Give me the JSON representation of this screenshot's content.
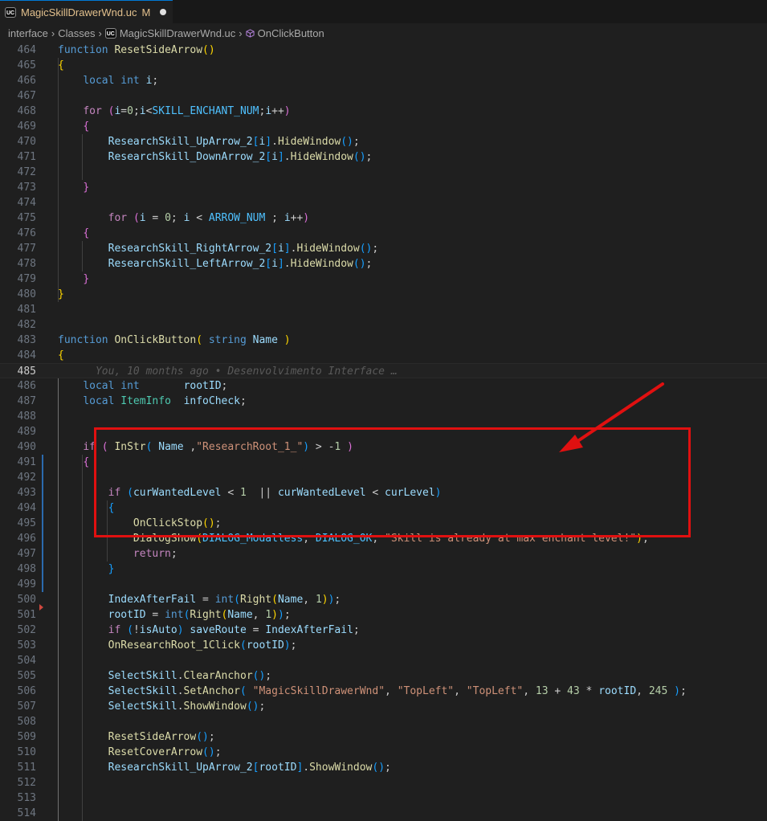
{
  "tab": {
    "badge": "UC",
    "title": "MagicSkillDrawerWnd.uc",
    "status": "M"
  },
  "breadcrumb": {
    "items": [
      "interface",
      "Classes",
      "MagicSkillDrawerWnd.uc",
      "OnClickButton"
    ],
    "file_badge": "UC"
  },
  "editor": {
    "active_line": "485",
    "git_blame": "You, 10 months ago • Desenvolvimento Interface …",
    "lines": [
      {
        "n": "464",
        "tokens": [
          [
            "t-kw",
            "function "
          ],
          [
            "t-fn",
            "ResetSideArrow"
          ],
          [
            "t-b1",
            "()"
          ]
        ]
      },
      {
        "n": "465",
        "tokens": [
          [
            "t-b1",
            "{"
          ]
        ]
      },
      {
        "n": "466",
        "tokens": [
          [
            "t-pl",
            "    "
          ],
          [
            "t-kw",
            "local "
          ],
          [
            "t-kw",
            "int "
          ],
          [
            "t-var",
            "i"
          ],
          [
            "t-pl",
            ";"
          ]
        ]
      },
      {
        "n": "467",
        "tokens": []
      },
      {
        "n": "468",
        "tokens": [
          [
            "t-pl",
            "    "
          ],
          [
            "t-ctl",
            "for "
          ],
          [
            "t-b2",
            "("
          ],
          [
            "t-var",
            "i"
          ],
          [
            "t-pl",
            "="
          ],
          [
            "t-num",
            "0"
          ],
          [
            "t-pl",
            ";"
          ],
          [
            "t-var",
            "i"
          ],
          [
            "t-pl",
            "<"
          ],
          [
            "t-con",
            "SKILL_ENCHANT_NUM"
          ],
          [
            "t-pl",
            ";"
          ],
          [
            "t-var",
            "i"
          ],
          [
            "t-pl",
            "++"
          ],
          [
            "t-b2",
            ")"
          ]
        ]
      },
      {
        "n": "469",
        "tokens": [
          [
            "t-pl",
            "    "
          ],
          [
            "t-b2",
            "{"
          ]
        ]
      },
      {
        "n": "470",
        "tokens": [
          [
            "t-pl",
            "        "
          ],
          [
            "t-var",
            "ResearchSkill_UpArrow_2"
          ],
          [
            "t-b3",
            "["
          ],
          [
            "t-var",
            "i"
          ],
          [
            "t-b3",
            "]"
          ],
          [
            "t-pl",
            "."
          ],
          [
            "t-fn",
            "HideWindow"
          ],
          [
            "t-b3",
            "()"
          ],
          [
            "t-pl",
            ";"
          ]
        ]
      },
      {
        "n": "471",
        "tokens": [
          [
            "t-pl",
            "        "
          ],
          [
            "t-var",
            "ResearchSkill_DownArrow_2"
          ],
          [
            "t-b3",
            "["
          ],
          [
            "t-var",
            "i"
          ],
          [
            "t-b3",
            "]"
          ],
          [
            "t-pl",
            "."
          ],
          [
            "t-fn",
            "HideWindow"
          ],
          [
            "t-b3",
            "()"
          ],
          [
            "t-pl",
            ";"
          ]
        ]
      },
      {
        "n": "472",
        "tokens": []
      },
      {
        "n": "473",
        "tokens": [
          [
            "t-pl",
            "    "
          ],
          [
            "t-b2",
            "}"
          ]
        ]
      },
      {
        "n": "474",
        "tokens": []
      },
      {
        "n": "475",
        "tokens": [
          [
            "t-pl",
            "        "
          ],
          [
            "t-ctl",
            "for "
          ],
          [
            "t-b2",
            "("
          ],
          [
            "t-var",
            "i"
          ],
          [
            "t-pl",
            " = "
          ],
          [
            "t-num",
            "0"
          ],
          [
            "t-pl",
            "; "
          ],
          [
            "t-var",
            "i"
          ],
          [
            "t-pl",
            " < "
          ],
          [
            "t-con",
            "ARROW_NUM"
          ],
          [
            "t-pl",
            " ; "
          ],
          [
            "t-var",
            "i"
          ],
          [
            "t-pl",
            "++"
          ],
          [
            "t-b2",
            ")"
          ]
        ]
      },
      {
        "n": "476",
        "tokens": [
          [
            "t-pl",
            "    "
          ],
          [
            "t-b2",
            "{"
          ]
        ]
      },
      {
        "n": "477",
        "tokens": [
          [
            "t-pl",
            "        "
          ],
          [
            "t-var",
            "ResearchSkill_RightArrow_2"
          ],
          [
            "t-b3",
            "["
          ],
          [
            "t-var",
            "i"
          ],
          [
            "t-b3",
            "]"
          ],
          [
            "t-pl",
            "."
          ],
          [
            "t-fn",
            "HideWindow"
          ],
          [
            "t-b3",
            "()"
          ],
          [
            "t-pl",
            ";"
          ]
        ]
      },
      {
        "n": "478",
        "tokens": [
          [
            "t-pl",
            "        "
          ],
          [
            "t-var",
            "ResearchSkill_LeftArrow_2"
          ],
          [
            "t-b3",
            "["
          ],
          [
            "t-var",
            "i"
          ],
          [
            "t-b3",
            "]"
          ],
          [
            "t-pl",
            "."
          ],
          [
            "t-fn",
            "HideWindow"
          ],
          [
            "t-b3",
            "()"
          ],
          [
            "t-pl",
            ";"
          ]
        ]
      },
      {
        "n": "479",
        "tokens": [
          [
            "t-pl",
            "    "
          ],
          [
            "t-b2",
            "}"
          ]
        ]
      },
      {
        "n": "480",
        "tokens": [
          [
            "t-b1",
            "}"
          ]
        ]
      },
      {
        "n": "481",
        "tokens": []
      },
      {
        "n": "482",
        "tokens": []
      },
      {
        "n": "483",
        "tokens": [
          [
            "t-kw",
            "function "
          ],
          [
            "t-fn",
            "OnClickButton"
          ],
          [
            "t-b1",
            "( "
          ],
          [
            "t-kw",
            "string "
          ],
          [
            "t-var",
            "Name"
          ],
          [
            "t-b1",
            " )"
          ]
        ]
      },
      {
        "n": "484",
        "tokens": [
          [
            "t-b1",
            "{"
          ]
        ]
      },
      {
        "n": "485",
        "tokens": []
      },
      {
        "n": "486",
        "tokens": [
          [
            "t-pl",
            "    "
          ],
          [
            "t-kw",
            "local "
          ],
          [
            "t-kw",
            "int       "
          ],
          [
            "t-var",
            "rootID"
          ],
          [
            "t-pl",
            ";"
          ]
        ]
      },
      {
        "n": "487",
        "tokens": [
          [
            "t-pl",
            "    "
          ],
          [
            "t-kw",
            "local "
          ],
          [
            "t-ty",
            "ItemInfo  "
          ],
          [
            "t-var",
            "infoCheck"
          ],
          [
            "t-pl",
            ";"
          ]
        ]
      },
      {
        "n": "488",
        "tokens": []
      },
      {
        "n": "489",
        "tokens": []
      },
      {
        "n": "490",
        "tokens": [
          [
            "t-pl",
            "    "
          ],
          [
            "t-ctl",
            "if "
          ],
          [
            "t-b2",
            "( "
          ],
          [
            "t-fn",
            "InStr"
          ],
          [
            "t-b3",
            "( "
          ],
          [
            "t-var",
            "Name"
          ],
          [
            "t-pl",
            " ,"
          ],
          [
            "t-str",
            "\"ResearchRoot_1_\""
          ],
          [
            "t-b3",
            ")"
          ],
          [
            "t-pl",
            " > -"
          ],
          [
            "t-num",
            "1"
          ],
          [
            "t-b2",
            " )"
          ]
        ]
      },
      {
        "n": "491",
        "tokens": [
          [
            "t-pl",
            "    "
          ],
          [
            "t-b2",
            "{"
          ]
        ]
      },
      {
        "n": "492",
        "tokens": []
      },
      {
        "n": "493",
        "tokens": [
          [
            "t-pl",
            "        "
          ],
          [
            "t-ctl",
            "if "
          ],
          [
            "t-b3",
            "("
          ],
          [
            "t-var",
            "curWantedLevel"
          ],
          [
            "t-pl",
            " < "
          ],
          [
            "t-num",
            "1"
          ],
          [
            "t-pl",
            "  || "
          ],
          [
            "t-var",
            "curWantedLevel"
          ],
          [
            "t-pl",
            " < "
          ],
          [
            "t-var",
            "curLevel"
          ],
          [
            "t-b3",
            ")"
          ]
        ]
      },
      {
        "n": "494",
        "tokens": [
          [
            "t-pl",
            "        "
          ],
          [
            "t-b3",
            "{"
          ]
        ]
      },
      {
        "n": "495",
        "tokens": [
          [
            "t-pl",
            "            "
          ],
          [
            "t-fn",
            "OnClickStop"
          ],
          [
            "t-b1",
            "()"
          ],
          [
            "t-pl",
            ";"
          ]
        ]
      },
      {
        "n": "496",
        "tokens": [
          [
            "t-pl",
            "            "
          ],
          [
            "t-fn",
            "DialogShow"
          ],
          [
            "t-b1",
            "("
          ],
          [
            "t-con",
            "DIALOG_Modalless"
          ],
          [
            "t-pl",
            ", "
          ],
          [
            "t-con",
            "DIALOG_OK"
          ],
          [
            "t-pl",
            ", "
          ],
          [
            "t-str",
            "\"Skill is already at max enchant level!\""
          ],
          [
            "t-b1",
            ")"
          ],
          [
            "t-pl",
            ";"
          ]
        ]
      },
      {
        "n": "497",
        "tokens": [
          [
            "t-pl",
            "            "
          ],
          [
            "t-ctl",
            "return"
          ],
          [
            "t-pl",
            ";"
          ]
        ]
      },
      {
        "n": "498",
        "tokens": [
          [
            "t-pl",
            "        "
          ],
          [
            "t-b3",
            "}"
          ]
        ]
      },
      {
        "n": "499",
        "tokens": []
      },
      {
        "n": "500",
        "tokens": [
          [
            "t-pl",
            "        "
          ],
          [
            "t-var",
            "IndexAfterFail"
          ],
          [
            "t-pl",
            " = "
          ],
          [
            "t-kw",
            "int"
          ],
          [
            "t-b3",
            "("
          ],
          [
            "t-fn",
            "Right"
          ],
          [
            "t-b1",
            "("
          ],
          [
            "t-var",
            "Name"
          ],
          [
            "t-pl",
            ", "
          ],
          [
            "t-num",
            "1"
          ],
          [
            "t-b1",
            ")"
          ],
          [
            "t-b3",
            ")"
          ],
          [
            "t-pl",
            ";"
          ]
        ]
      },
      {
        "n": "501",
        "tokens": [
          [
            "t-pl",
            "        "
          ],
          [
            "t-var",
            "rootID"
          ],
          [
            "t-pl",
            " = "
          ],
          [
            "t-kw",
            "int"
          ],
          [
            "t-b3",
            "("
          ],
          [
            "t-fn",
            "Right"
          ],
          [
            "t-b1",
            "("
          ],
          [
            "t-var",
            "Name"
          ],
          [
            "t-pl",
            ", "
          ],
          [
            "t-num",
            "1"
          ],
          [
            "t-b1",
            ")"
          ],
          [
            "t-b3",
            ")"
          ],
          [
            "t-pl",
            ";"
          ]
        ]
      },
      {
        "n": "502",
        "tokens": [
          [
            "t-pl",
            "        "
          ],
          [
            "t-ctl",
            "if "
          ],
          [
            "t-b3",
            "("
          ],
          [
            "t-pl",
            "!"
          ],
          [
            "t-var",
            "isAuto"
          ],
          [
            "t-b3",
            ")"
          ],
          [
            "t-pl",
            " "
          ],
          [
            "t-var",
            "saveRoute"
          ],
          [
            "t-pl",
            " = "
          ],
          [
            "t-var",
            "IndexAfterFail"
          ],
          [
            "t-pl",
            ";"
          ]
        ]
      },
      {
        "n": "503",
        "tokens": [
          [
            "t-pl",
            "        "
          ],
          [
            "t-fn",
            "OnResearchRoot_1Click"
          ],
          [
            "t-b3",
            "("
          ],
          [
            "t-var",
            "rootID"
          ],
          [
            "t-b3",
            ")"
          ],
          [
            "t-pl",
            ";"
          ]
        ]
      },
      {
        "n": "504",
        "tokens": []
      },
      {
        "n": "505",
        "tokens": [
          [
            "t-pl",
            "        "
          ],
          [
            "t-var",
            "SelectSkill"
          ],
          [
            "t-pl",
            "."
          ],
          [
            "t-fn",
            "ClearAnchor"
          ],
          [
            "t-b3",
            "()"
          ],
          [
            "t-pl",
            ";"
          ]
        ]
      },
      {
        "n": "506",
        "tokens": [
          [
            "t-pl",
            "        "
          ],
          [
            "t-var",
            "SelectSkill"
          ],
          [
            "t-pl",
            "."
          ],
          [
            "t-fn",
            "SetAnchor"
          ],
          [
            "t-b3",
            "( "
          ],
          [
            "t-str",
            "\"MagicSkillDrawerWnd\""
          ],
          [
            "t-pl",
            ", "
          ],
          [
            "t-str",
            "\"TopLeft\""
          ],
          [
            "t-pl",
            ", "
          ],
          [
            "t-str",
            "\"TopLeft\""
          ],
          [
            "t-pl",
            ", "
          ],
          [
            "t-num",
            "13"
          ],
          [
            "t-pl",
            " + "
          ],
          [
            "t-num",
            "43"
          ],
          [
            "t-pl",
            " * "
          ],
          [
            "t-var",
            "rootID"
          ],
          [
            "t-pl",
            ", "
          ],
          [
            "t-num",
            "245"
          ],
          [
            "t-b3",
            " )"
          ],
          [
            "t-pl",
            ";"
          ]
        ]
      },
      {
        "n": "507",
        "tokens": [
          [
            "t-pl",
            "        "
          ],
          [
            "t-var",
            "SelectSkill"
          ],
          [
            "t-pl",
            "."
          ],
          [
            "t-fn",
            "ShowWindow"
          ],
          [
            "t-b3",
            "()"
          ],
          [
            "t-pl",
            ";"
          ]
        ]
      },
      {
        "n": "508",
        "tokens": []
      },
      {
        "n": "509",
        "tokens": [
          [
            "t-pl",
            "        "
          ],
          [
            "t-fn",
            "ResetSideArrow"
          ],
          [
            "t-b3",
            "()"
          ],
          [
            "t-pl",
            ";"
          ]
        ]
      },
      {
        "n": "510",
        "tokens": [
          [
            "t-pl",
            "        "
          ],
          [
            "t-fn",
            "ResetCoverArrow"
          ],
          [
            "t-b3",
            "()"
          ],
          [
            "t-pl",
            ";"
          ]
        ]
      },
      {
        "n": "511",
        "tokens": [
          [
            "t-pl",
            "        "
          ],
          [
            "t-var",
            "ResearchSkill_UpArrow_2"
          ],
          [
            "t-b3",
            "["
          ],
          [
            "t-var",
            "rootID"
          ],
          [
            "t-b3",
            "]"
          ],
          [
            "t-pl",
            "."
          ],
          [
            "t-fn",
            "ShowWindow"
          ],
          [
            "t-b3",
            "()"
          ],
          [
            "t-pl",
            ";"
          ]
        ]
      },
      {
        "n": "512",
        "tokens": []
      },
      {
        "n": "513",
        "tokens": []
      },
      {
        "n": "514",
        "tokens": []
      }
    ]
  },
  "annotation": {
    "box_color": "#e01010",
    "arrow_color": "#e01010"
  },
  "colors": {
    "background": "#1f1f1f",
    "modified": "#e2c08d",
    "accent": "#0078d4"
  }
}
